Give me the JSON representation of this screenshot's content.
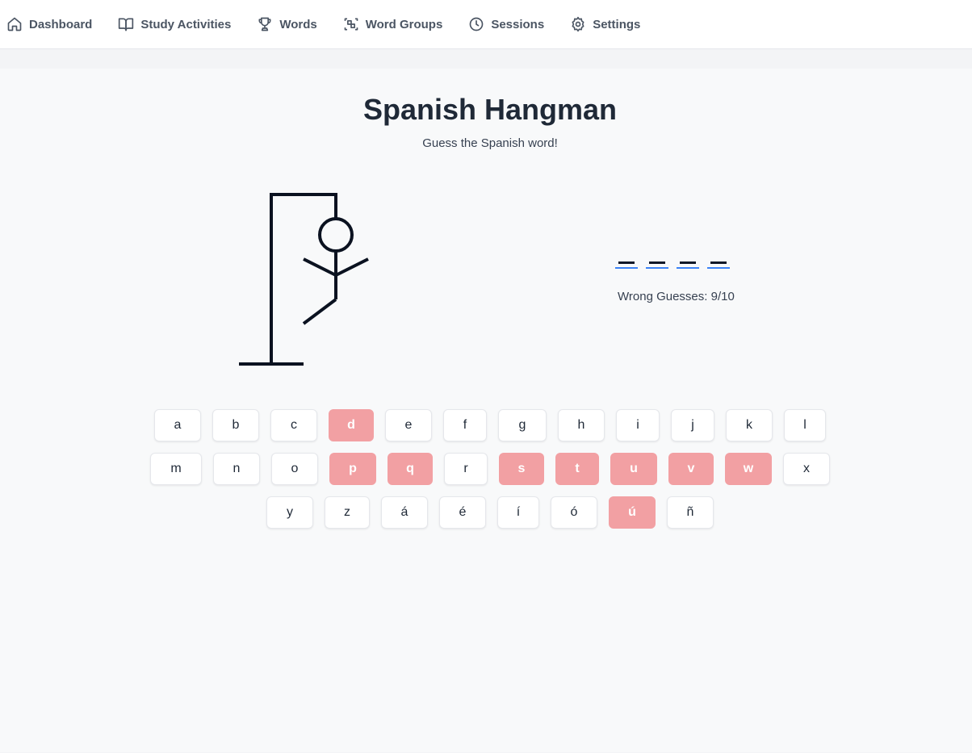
{
  "nav": {
    "items": [
      {
        "label": "Dashboard",
        "icon": "home-icon"
      },
      {
        "label": "Study Activities",
        "icon": "book-icon"
      },
      {
        "label": "Words",
        "icon": "trophy-icon"
      },
      {
        "label": "Word Groups",
        "icon": "scan-group-icon"
      },
      {
        "label": "Sessions",
        "icon": "clock-icon"
      },
      {
        "label": "Settings",
        "icon": "gear-icon"
      }
    ]
  },
  "game": {
    "title": "Spanish Hangman",
    "subtitle": "Guess the Spanish word!",
    "word_slots": [
      "",
      "",
      "",
      ""
    ],
    "wrong_guesses": "Wrong Guesses: 9/10"
  },
  "keyboard": {
    "rows": [
      [
        "a",
        "b",
        "c",
        "d",
        "e",
        "f",
        "g",
        "h",
        "i",
        "j",
        "k",
        "l"
      ],
      [
        "m",
        "n",
        "o",
        "p",
        "q",
        "r",
        "s",
        "t",
        "u",
        "v",
        "w",
        "x"
      ],
      [
        "y",
        "z",
        "á",
        "é",
        "í",
        "ó",
        "ú",
        "ñ"
      ]
    ],
    "used": [
      "d",
      "p",
      "q",
      "s",
      "t",
      "u",
      "v",
      "w",
      "ú"
    ]
  },
  "colors": {
    "used_key": "#f2a0a3",
    "underline_accent": "#3b82f6",
    "text_dark": "#1f2937"
  }
}
